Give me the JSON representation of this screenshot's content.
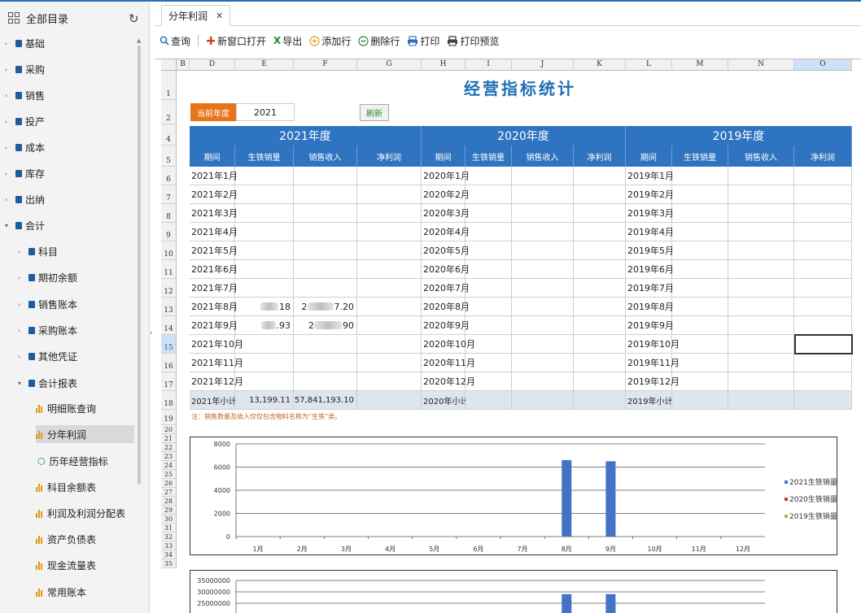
{
  "sidebar": {
    "title": "全部目录",
    "items": [
      {
        "label": "基础",
        "depth": 0,
        "expanded": false,
        "type": "folder"
      },
      {
        "label": "采购",
        "depth": 0,
        "expanded": false,
        "type": "folder"
      },
      {
        "label": "销售",
        "depth": 0,
        "expanded": false,
        "type": "folder"
      },
      {
        "label": "投产",
        "depth": 0,
        "expanded": false,
        "type": "folder"
      },
      {
        "label": "成本",
        "depth": 0,
        "expanded": false,
        "type": "folder"
      },
      {
        "label": "库存",
        "depth": 0,
        "expanded": false,
        "type": "folder"
      },
      {
        "label": "出纳",
        "depth": 0,
        "expanded": false,
        "type": "folder"
      },
      {
        "label": "会计",
        "depth": 0,
        "expanded": true,
        "type": "folder"
      },
      {
        "label": "科目",
        "depth": 1,
        "expanded": false,
        "type": "folder"
      },
      {
        "label": "期初余额",
        "depth": 1,
        "expanded": false,
        "type": "folder"
      },
      {
        "label": "销售账本",
        "depth": 1,
        "expanded": false,
        "type": "folder"
      },
      {
        "label": "采购账本",
        "depth": 1,
        "expanded": false,
        "type": "folder"
      },
      {
        "label": "其他凭证",
        "depth": 1,
        "expanded": false,
        "type": "folder"
      },
      {
        "label": "会计报表",
        "depth": 1,
        "expanded": true,
        "type": "folder"
      },
      {
        "label": "明细账查询",
        "depth": 2,
        "type": "report",
        "active": false
      },
      {
        "label": "分年利润",
        "depth": 2,
        "type": "report",
        "active": true
      },
      {
        "label": "历年经营指标",
        "depth": 2,
        "type": "cube",
        "active": false
      },
      {
        "label": "科目余额表",
        "depth": 2,
        "type": "report",
        "active": false
      },
      {
        "label": "利润及利润分配表",
        "depth": 2,
        "type": "report",
        "active": false
      },
      {
        "label": "资产负债表",
        "depth": 2,
        "type": "report",
        "active": false
      },
      {
        "label": "现金流量表",
        "depth": 2,
        "type": "report",
        "active": false
      },
      {
        "label": "常用账本",
        "depth": 2,
        "type": "report",
        "active": false
      }
    ]
  },
  "tab": {
    "label": "分年利润"
  },
  "toolbar": {
    "query": "查询",
    "new_window": "新窗口打开",
    "export": "导出",
    "add_row": "添加行",
    "delete_row": "删除行",
    "print": "打印",
    "print_preview": "打印预览"
  },
  "sheet": {
    "columns": [
      "B",
      "D",
      "E",
      "F",
      "G",
      "H",
      "I",
      "J",
      "K",
      "L",
      "M",
      "N",
      "O"
    ],
    "selected_column": "O",
    "selected_row": "15",
    "rows": [
      "1",
      "2",
      "4",
      "5",
      "6",
      "7",
      "8",
      "9",
      "10",
      "11",
      "12",
      "13",
      "14",
      "15",
      "16",
      "17",
      "18",
      "19",
      "20",
      "21",
      "22",
      "23",
      "24",
      "25",
      "26",
      "27",
      "28",
      "29",
      "30",
      "31",
      "32",
      "33",
      "34",
      "35"
    ],
    "title": "经营指标统计",
    "current_year_label": "当前年度",
    "current_year": "2021",
    "refresh_label": "刷新",
    "year_headers": [
      "2021年度",
      "2020年度",
      "2019年度"
    ],
    "sub_headers": [
      "期间",
      "生铁销量",
      "销售收入",
      "净利润"
    ],
    "months_2021": [
      "2021年1月",
      "2021年2月",
      "2021年3月",
      "2021年4月",
      "2021年5月",
      "2021年6月",
      "2021年7月",
      "2021年8月",
      "2021年9月",
      "2021年10月",
      "2021年11月",
      "2021年12月"
    ],
    "months_2020": [
      "2020年1月",
      "2020年2月",
      "2020年3月",
      "2020年4月",
      "2020年5月",
      "2020年6月",
      "2020年7月",
      "2020年8月",
      "2020年9月",
      "2020年10月",
      "2020年11月",
      "2020年12月"
    ],
    "months_2019": [
      "2019年1月",
      "2019年2月",
      "2019年3月",
      "2019年4月",
      "2019年5月",
      "2019年6月",
      "2019年7月",
      "2019年8月",
      "2019年9月",
      "2019年10月",
      "2019年11月",
      "2019年12月"
    ],
    "row_aug_sales_tail": "18",
    "row_aug_rev_head": "2",
    "row_aug_rev_tail": "7.20",
    "row_sep_sales_tail": ".93",
    "row_sep_rev_head": "2",
    "row_sep_rev_tail": "90",
    "subtotal_2021_label": "2021年小计",
    "subtotal_2021_sales": "13,199.11",
    "subtotal_2021_revenue": "57,841,193.10",
    "subtotal_2020_label": "2020年小计",
    "subtotal_2019_label": "2019年小计",
    "note": "注：销售数量及收入仅仅包含物料名称为“生铁”类。"
  },
  "chart_data": [
    {
      "type": "bar",
      "categories": [
        "1月",
        "2月",
        "3月",
        "4月",
        "5月",
        "6月",
        "7月",
        "8月",
        "9月",
        "10月",
        "11月",
        "12月"
      ],
      "series": [
        {
          "name": "2021生铁销量",
          "values": [
            0,
            0,
            0,
            0,
            0,
            0,
            0,
            6600,
            6500,
            0,
            0,
            0
          ],
          "color": "#4472c4"
        },
        {
          "name": "2020生铁销量",
          "values": [
            0,
            0,
            0,
            0,
            0,
            0,
            0,
            0,
            0,
            0,
            0,
            0
          ],
          "color": "#c0392b"
        },
        {
          "name": "2019生铁销量",
          "values": [
            0,
            0,
            0,
            0,
            0,
            0,
            0,
            0,
            0,
            0,
            0,
            0
          ],
          "color": "#8bc34a"
        }
      ],
      "yticks": [
        "8000",
        "6000",
        "4000",
        "2000",
        "0"
      ],
      "ylim": [
        0,
        8000
      ],
      "legend": "right",
      "grid": true
    },
    {
      "type": "bar",
      "categories": [
        "1月",
        "2月",
        "3月",
        "4月",
        "5月",
        "6月",
        "7月",
        "8月",
        "9月",
        "10月",
        "11月",
        "12月"
      ],
      "series": [
        {
          "values": [
            0,
            0,
            0,
            0,
            0,
            0,
            0,
            29000000,
            29000000,
            0,
            0,
            0
          ],
          "color": "#4472c4"
        }
      ],
      "yticks": [
        "35000000",
        "30000000",
        "25000000"
      ],
      "ylim": [
        0,
        35000000
      ],
      "grid": true
    }
  ],
  "colors": {
    "accent": "#2f74c0",
    "orange": "#e8741a",
    "title": "#1f6eb5"
  }
}
